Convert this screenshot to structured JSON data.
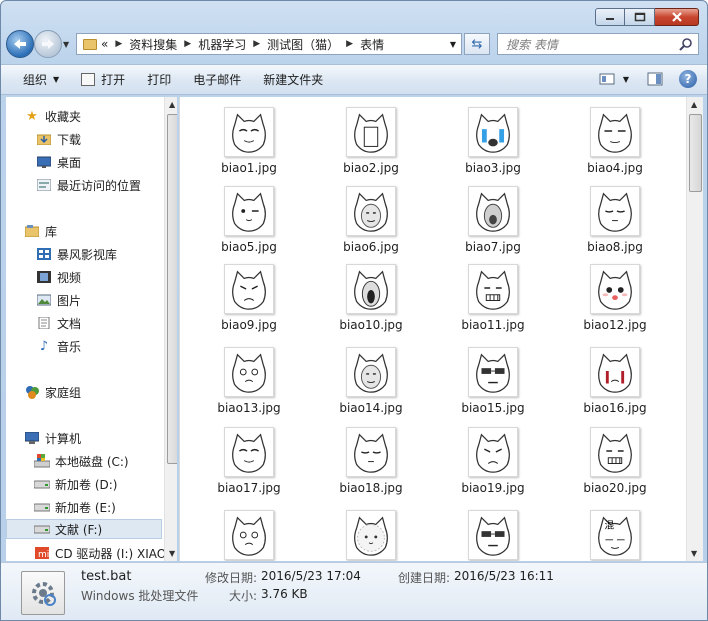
{
  "titlebar": {
    "minimize_icon": "minimize-icon",
    "maximize_icon": "maximize-icon",
    "close_icon": "close-icon"
  },
  "address": {
    "overflow": "«",
    "crumbs": [
      "资料搜集",
      "机器学习",
      "测试图（猫）",
      "表情"
    ]
  },
  "search": {
    "placeholder": "搜索 表情"
  },
  "toolbar": {
    "organize": "组织",
    "open": "打开",
    "print": "打印",
    "email": "电子邮件",
    "new_folder": "新建文件夹"
  },
  "nav": {
    "favorites": "收藏夹",
    "downloads": "下载",
    "desktop": "桌面",
    "recent": "最近访问的位置",
    "libraries": "库",
    "baofeng": "暴风影视库",
    "videos": "视频",
    "pictures": "图片",
    "documents": "文档",
    "music": "音乐",
    "homegroup": "家庭组",
    "computer": "计算机",
    "drive_c": "本地磁盘 (C:)",
    "drive_d": "新加卷 (D:)",
    "drive_e": "新加卷 (E:)",
    "drive_f": "文献 (F:)",
    "drive_i": "CD 驱动器 (I:) XIAO"
  },
  "files": [
    {
      "name": "biao1.jpg",
      "face": "smug"
    },
    {
      "name": "biao2.jpg",
      "face": "shock"
    },
    {
      "name": "biao3.jpg",
      "face": "crying"
    },
    {
      "name": "biao4.jpg",
      "face": "squint"
    },
    {
      "name": "biao5.jpg",
      "face": "wink"
    },
    {
      "name": "biao6.jpg",
      "face": "human"
    },
    {
      "name": "biao7.jpg",
      "face": "yell"
    },
    {
      "name": "biao8.jpg",
      "face": "sleepy"
    },
    {
      "name": "biao9.jpg",
      "face": "sad"
    },
    {
      "name": "biao10.jpg",
      "face": "scream"
    },
    {
      "name": "biao11.jpg",
      "face": "grin"
    },
    {
      "name": "biao12.jpg",
      "face": "cute"
    },
    {
      "name": "biao13.jpg",
      "face": "teary"
    },
    {
      "name": "biao14.jpg",
      "face": "human"
    },
    {
      "name": "biao15.jpg",
      "face": "glasses"
    },
    {
      "name": "biao16.jpg",
      "face": "bleed"
    },
    {
      "name": "biao17.jpg",
      "face": "smug"
    },
    {
      "name": "biao18.jpg",
      "face": "sleepy"
    },
    {
      "name": "biao19.jpg",
      "face": "sad"
    },
    {
      "name": "biao20.jpg",
      "face": "grin"
    },
    {
      "name": "",
      "face": "teary"
    },
    {
      "name": "",
      "face": "fluffy"
    },
    {
      "name": "",
      "face": "glasses"
    },
    {
      "name": "",
      "face": "text",
      "text": "混"
    }
  ],
  "details": {
    "filename": "test.bat",
    "filetype": "Windows 批处理文件",
    "modified_label": "修改日期:",
    "modified_value": "2016/5/23 17:04",
    "created_label": "创建日期:",
    "created_value": "2016/5/23 16:11",
    "size_label": "大小:",
    "size_value": "3.76 KB"
  }
}
